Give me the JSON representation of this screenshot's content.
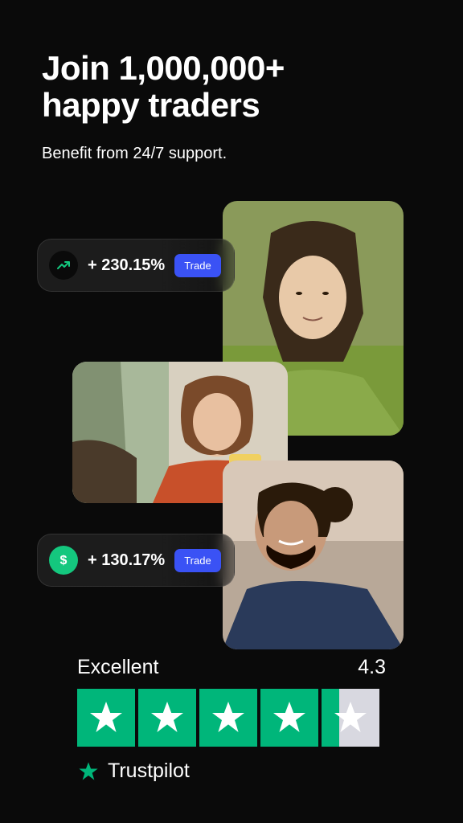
{
  "heading_line1": "Join 1,000,000+",
  "heading_line2": "happy traders",
  "subtitle": "Benefit from 24/7 support.",
  "pills": [
    {
      "value": "+ 230.15%",
      "button": "Trade"
    },
    {
      "value": "+ 130.17%",
      "button": "Trade"
    }
  ],
  "trustpilot": {
    "label": "Excellent",
    "score": "4.3",
    "brand": "Trustpilot"
  }
}
